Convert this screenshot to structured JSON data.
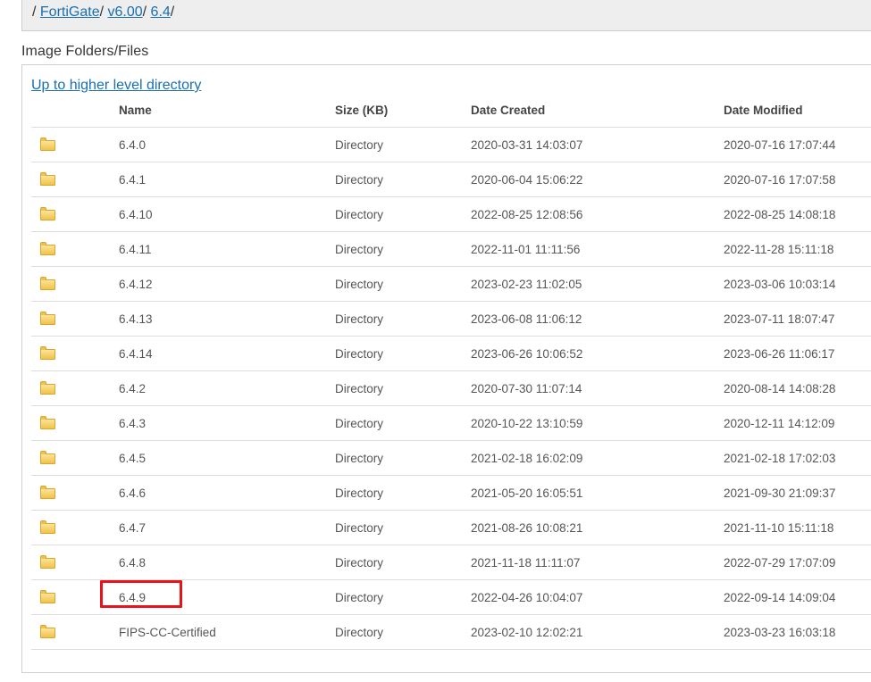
{
  "breadcrumb": {
    "sep": "/",
    "items": [
      "FortiGate",
      "v6.00",
      "6.4"
    ]
  },
  "section_title": "Image Folders/Files",
  "up_link": "Up to higher level directory",
  "table": {
    "headers": [
      "Name",
      "Size (KB)",
      "Date Created",
      "Date Modified"
    ],
    "rows": [
      {
        "name": "6.4.0",
        "size": "Directory",
        "created": "2020-03-31 14:03:07",
        "modified": "2020-07-16 17:07:44"
      },
      {
        "name": "6.4.1",
        "size": "Directory",
        "created": "2020-06-04 15:06:22",
        "modified": "2020-07-16 17:07:58"
      },
      {
        "name": "6.4.10",
        "size": "Directory",
        "created": "2022-08-25 12:08:56",
        "modified": "2022-08-25 14:08:18"
      },
      {
        "name": "6.4.11",
        "size": "Directory",
        "created": "2022-11-01 11:11:56",
        "modified": "2022-11-28 15:11:18"
      },
      {
        "name": "6.4.12",
        "size": "Directory",
        "created": "2023-02-23 11:02:05",
        "modified": "2023-03-06 10:03:14"
      },
      {
        "name": "6.4.13",
        "size": "Directory",
        "created": "2023-06-08 11:06:12",
        "modified": "2023-07-11 18:07:47"
      },
      {
        "name": "6.4.14",
        "size": "Directory",
        "created": "2023-06-26 10:06:52",
        "modified": "2023-06-26 11:06:17"
      },
      {
        "name": "6.4.2",
        "size": "Directory",
        "created": "2020-07-30 11:07:14",
        "modified": "2020-08-14 14:08:28"
      },
      {
        "name": "6.4.3",
        "size": "Directory",
        "created": "2020-10-22 13:10:59",
        "modified": "2020-12-11 14:12:09"
      },
      {
        "name": "6.4.5",
        "size": "Directory",
        "created": "2021-02-18 16:02:09",
        "modified": "2021-02-18 17:02:03"
      },
      {
        "name": "6.4.6",
        "size": "Directory",
        "created": "2021-05-20 16:05:51",
        "modified": "2021-09-30 21:09:37"
      },
      {
        "name": "6.4.7",
        "size": "Directory",
        "created": "2021-08-26 10:08:21",
        "modified": "2021-11-10 15:11:18"
      },
      {
        "name": "6.4.8",
        "size": "Directory",
        "created": "2021-11-18 11:11:07",
        "modified": "2022-07-29 17:07:09"
      },
      {
        "name": "6.4.9",
        "size": "Directory",
        "created": "2022-04-26 10:04:07",
        "modified": "2022-09-14 14:09:04"
      },
      {
        "name": "FIPS-CC-Certified",
        "size": "Directory",
        "created": "2023-02-10 12:02:21",
        "modified": "2023-03-23 16:03:18"
      }
    ],
    "row_icon": "folder-icon"
  },
  "annotation": {
    "target_row": "6.4.9",
    "color": "#e8141b"
  },
  "colors": {
    "link": "#1a6fb0",
    "breadcrumb_bg": "#eeeeee",
    "folder": "#f2c24a"
  }
}
